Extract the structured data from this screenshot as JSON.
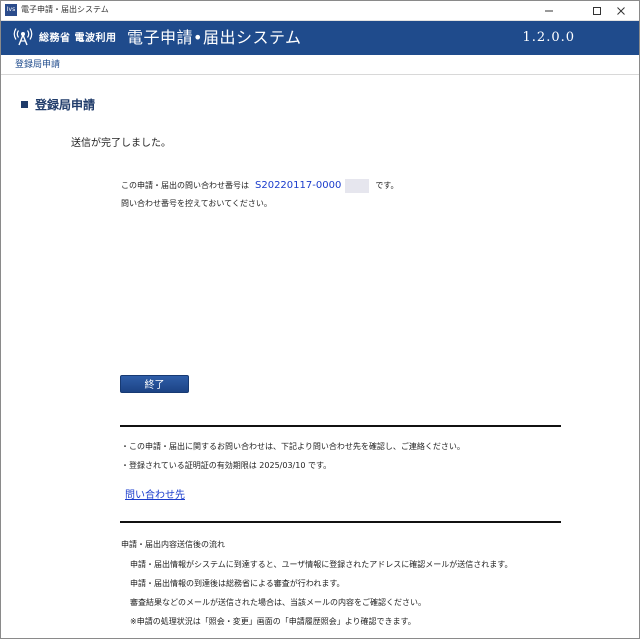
{
  "window": {
    "title": "電子申請・届出システム",
    "app_icon_text": "Ivs"
  },
  "header": {
    "ministry": "総務省 電波利用",
    "title": "電子申請•届出システム",
    "version": "1.2.0.0",
    "bg_color": "#1f4b8c"
  },
  "breadcrumb": "登録局申請",
  "main": {
    "page_title": "登録局申請",
    "complete_message": "送信が完了しました。",
    "inquiry_prefix": "この申請・届出の問い合わせ番号は",
    "inquiry_number": "S20220117-0000",
    "inquiry_suffix": "です。",
    "note": "問い合わせ番号を控えておいてください。",
    "finish_label": "終了",
    "info_1": "・この申請・届出に関するお問い合わせは、下記より問い合わせ先を確認し、ご連絡ください。",
    "info_2": "・登録されている証明証の有効期限は 2025/03/10 です。",
    "contact_link": "問い合わせ先",
    "flow_title": "申請・届出内容送信後の流れ",
    "flow_items": [
      "申請・届出情報がシステムに到達すると、ユーザ情報に登録されたアドレスに確認メールが送信されます。",
      "申請・届出情報の到達後は総務省による審査が行われます。",
      "審査結果などのメールが送信された場合は、当該メールの内容をご確認ください。",
      "※申請の処理状況は「照会・変更」画面の「申請履歴照会」より確認できます。"
    ]
  },
  "colors": {
    "accent": "#1f4b8c",
    "link": "#1a3ccc"
  }
}
